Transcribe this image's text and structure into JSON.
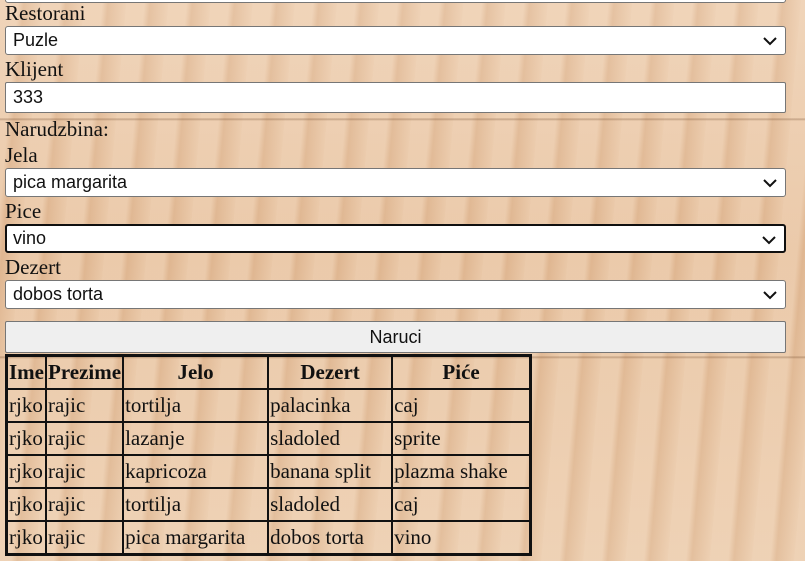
{
  "form": {
    "restaurants": {
      "label": "Restorani",
      "value": "Puzle"
    },
    "client": {
      "label": "Klijent",
      "value": "333"
    },
    "order_heading": "Narudzbina:",
    "food": {
      "label": "Jela",
      "value": "pica margarita"
    },
    "drink": {
      "label": "Pice",
      "value": "vino"
    },
    "dessert": {
      "label": "Dezert",
      "value": "dobos torta"
    },
    "submit_label": "Naruci"
  },
  "orders_table": {
    "headers": [
      "Ime",
      "Prezime",
      "Jelo",
      "Dezert",
      "Piće"
    ],
    "rows": [
      [
        "rjko",
        "rajic",
        "tortilja",
        "palacinka",
        "caj"
      ],
      [
        "rjko",
        "rajic",
        "lazanje",
        "sladoled",
        "sprite"
      ],
      [
        "rjko",
        "rajic",
        "kapricoza",
        "banana split",
        "plazma shake"
      ],
      [
        "rjko",
        "rajic",
        "tortilja",
        "sladoled",
        "caj"
      ],
      [
        "rjko",
        "rajic",
        "pica margarita",
        "dobos torta",
        "vino"
      ]
    ]
  },
  "icons": {
    "select_arrow": "chevron-down-icon"
  }
}
